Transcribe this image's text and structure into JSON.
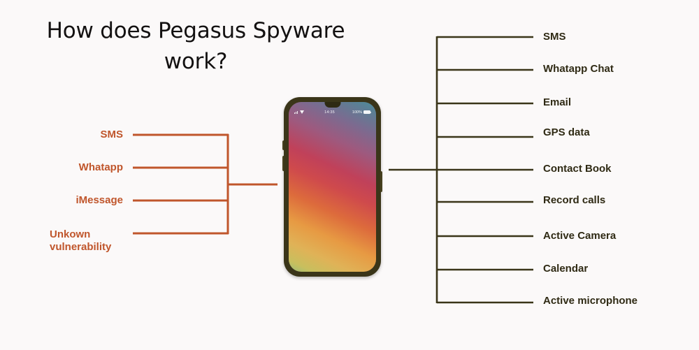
{
  "page": {
    "background_color": "#fbf9f9",
    "title": "How does Pegasus Spyware\nwork?",
    "title_color": "#131111"
  },
  "colors": {
    "infection_accent": "#c0562c",
    "exfiltration_accent": "#3a3519",
    "phone_bezel": "#3a3519"
  },
  "infection_vectors": {
    "heading": "",
    "items": [
      {
        "label": "SMS",
        "two_line": false
      },
      {
        "label": "Whatapp",
        "two_line": false
      },
      {
        "label": "iMessage",
        "two_line": false
      },
      {
        "label": "Unkown\nvulnerability",
        "two_line": true
      }
    ]
  },
  "exfiltrated_data": {
    "heading": "",
    "items": [
      {
        "label": "SMS"
      },
      {
        "label": "Whatapp Chat"
      },
      {
        "label": "Email"
      },
      {
        "label": "GPS data"
      },
      {
        "label": "Contact Book"
      },
      {
        "label": "Record calls"
      },
      {
        "label": "Active Camera"
      },
      {
        "label": "Calendar"
      },
      {
        "label": "Active microphone"
      }
    ]
  },
  "phone": {
    "status_bar": {
      "signal_icon": "signal-bars-icon",
      "wifi_icon": "wifi-icon",
      "time": "14:35",
      "battery_percent": "100%",
      "battery_icon": "battery-full-icon"
    },
    "notch_icon": "notch",
    "wallpaper": "diagonal-gradient-wallpaper"
  }
}
